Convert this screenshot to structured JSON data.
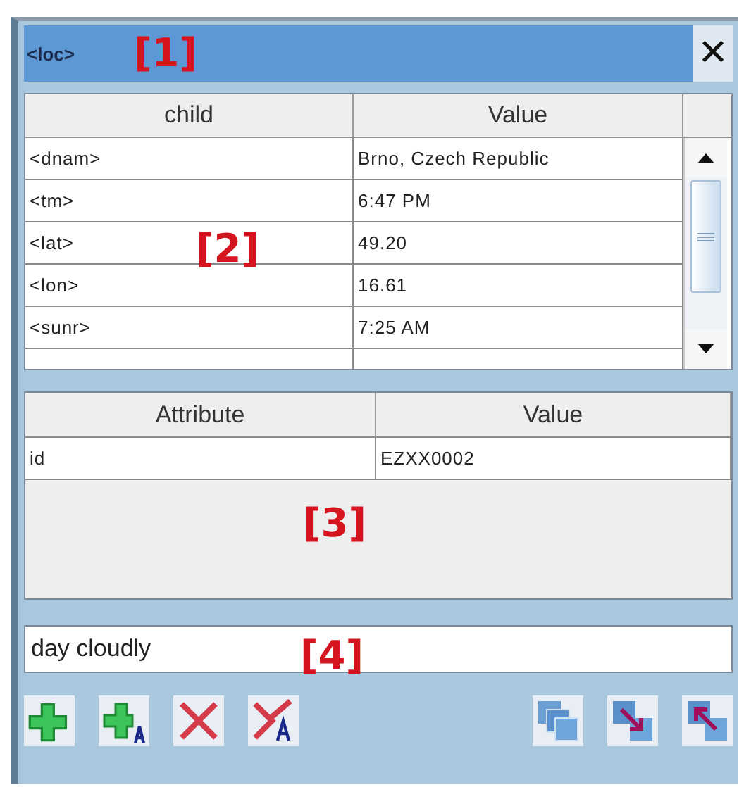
{
  "window": {
    "title": "<loc>",
    "close": "✕"
  },
  "child_table": {
    "columns": [
      "child",
      "Value"
    ],
    "rows": [
      {
        "child": "<dnam>",
        "value": "Brno, Czech Republic"
      },
      {
        "child": "<tm>",
        "value": "6:47 PM"
      },
      {
        "child": "<lat>",
        "value": "49.20"
      },
      {
        "child": "<lon>",
        "value": "16.61"
      },
      {
        "child": "<sunr>",
        "value": "7:25 AM"
      }
    ]
  },
  "attribute_table": {
    "columns": [
      "Attribute",
      "Value"
    ],
    "rows": [
      {
        "attribute": "id",
        "value": "EZXX0002"
      }
    ]
  },
  "text_field": {
    "value": "day cloudly"
  },
  "toolbar": {
    "left": [
      {
        "kind": "add"
      },
      {
        "kind": "add-attr"
      },
      {
        "kind": "delete"
      },
      {
        "kind": "delete-attr"
      }
    ],
    "right": [
      {
        "kind": "copy"
      },
      {
        "kind": "collapse"
      },
      {
        "kind": "expand"
      }
    ]
  },
  "annotations": [
    "[1]",
    "[2]",
    "[3]",
    "[4]"
  ]
}
